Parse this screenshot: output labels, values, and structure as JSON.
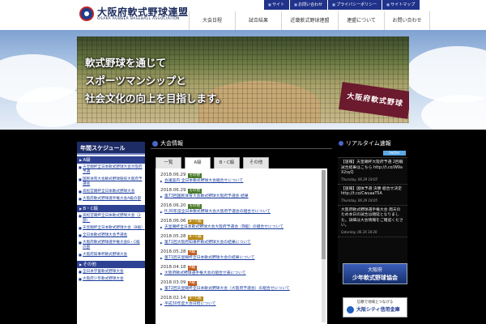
{
  "header": {
    "logo_title": "大阪府軟式野球連盟",
    "logo_subtitle": "OSAKA RUBBER BASEBALL ASSOCIATION",
    "top_links": [
      "サイト",
      "お問い合わせ",
      "プライバシーポリシー",
      "サイトマップ"
    ],
    "nav": [
      "大会日程",
      "試合結果",
      "近畿軟式野球連盟",
      "連盟について",
      "お問い合わせ"
    ]
  },
  "hero": {
    "lines": [
      "軟式野球を通じて",
      "スポーツマンシップと",
      "社会文化の向上を目指します。"
    ],
    "banner_text": "大阪府軟式野球"
  },
  "sidebar": {
    "title": "年間スケジュール",
    "sections": [
      {
        "label": "A級",
        "items": [
          "天皇賜杯全日本軟式野球大会大阪府予選",
          "国民体育大会軟式野球競技大阪府予選会",
          "高松宮賜杯全日本軟式野球大会",
          "大阪府軟式野球選手権大会A級の部"
        ]
      },
      {
        "label": "B・C級",
        "items": [
          "高松宮賜杯全日本軟式野球大会（2部）",
          "天皇賜杯全日本軟式野球大会（B級）",
          "全日本軟式野球大会予選会",
          "大阪府軟式野球選手権大会B・C級の部",
          "大阪府知事杯軟式野球大会"
        ]
      },
      {
        "label": "その他",
        "items": [
          "全日本学童軟式野球大会",
          "大阪府少年軟式野球大会"
        ]
      }
    ]
  },
  "news": {
    "title": "大会情報",
    "tabs": [
      "一覧",
      "A級",
      "B・C級",
      "その他"
    ],
    "items": [
      {
        "date": "2018.06.29",
        "tag": "その他",
        "tag_color": "#4a7a2a",
        "title": "会議案内 全日本軟式野球大会組合せについて"
      },
      {
        "date": "2018.06.29",
        "tag": "その他",
        "tag_color": "#4a7a2a",
        "title": "第73回国民体育大会軟式野球大阪府予選会 結果"
      },
      {
        "date": "2018.06.20",
        "tag": "その他",
        "tag_color": "#4a7a2a",
        "title": "H.30年度全日本軟式野球大会大阪府予選会の組合せについて"
      },
      {
        "date": "2018.06.06",
        "tag": "B・C級",
        "tag_color": "#b88a1a",
        "title": "天皇賜杯全日本軟式野球大会大阪府予選会（B級）の組合せについて"
      },
      {
        "date": "2018.05.28",
        "tag": "B・C級",
        "tag_color": "#b88a1a",
        "title": "第71回大阪府知事杯軟式野球大会の結果について"
      },
      {
        "date": "2018.05.28",
        "tag": "A級",
        "tag_color": "#c25a1a",
        "title": "第71回天皇賜杯全日本軟式野球大会の結果について"
      },
      {
        "date": "2018.04.18",
        "tag": "A級",
        "tag_color": "#c25a1a",
        "title": "大阪府軟式野球選手権大会の組合せ表について"
      },
      {
        "date": "2018.03.09",
        "tag": "A級",
        "tag_color": "#c25a1a",
        "title": "第72回天皇賜杯全日本軟式野球大会（大阪府予選会）の組合せについて"
      },
      {
        "date": "2018.02.14",
        "tag": "B・C級",
        "tag_color": "#b88a1a",
        "title": "平成30年度大会日程について"
      }
    ]
  },
  "realtime": {
    "title": "リアルタイム速報",
    "badge": "twitter",
    "tweets": [
      {
        "text": "【速報】天皇賜杯大阪府予選 2回戦 試合結果はこちら http://t.co/W9aX2syQ",
        "time": "Thursday, 06.29 18:05"
      },
      {
        "text": "【速報】国体予選 決勝 組合せ決定 http://t.co/CwuaaT5A",
        "time": "Thursday, 06.29 18:05"
      },
      {
        "text": "大阪府軟式野球選手権大会 雨天のため本日の試合は順延となりました。詳細は大会情報をご確認ください。",
        "time": "Saturday, 06.16 18:20"
      }
    ]
  },
  "banners": {
    "banner1_line1": "大阪府",
    "banner1_line2": "少年軟式野球協会",
    "banner2_line1": "信頼で地域とつなげる",
    "banner2_line2": "大阪シティ信用金庫"
  }
}
